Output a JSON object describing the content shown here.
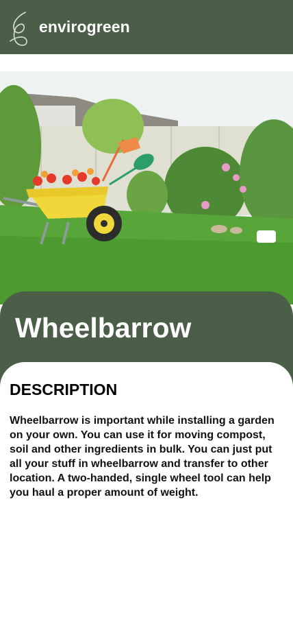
{
  "header": {
    "brand": "envirogreen",
    "logo_icon": "leaf-logo-icon",
    "background": "#4a5e48"
  },
  "hero": {
    "image_icon": "garden-wheelbarrow-image"
  },
  "product": {
    "title": "Wheelbarrow"
  },
  "description": {
    "heading": "DESCRIPTION",
    "text": "Wheelbarrow is important while installing a garden on your own. You can use it for moving compost, soil and other ingredients in bulk. You can just put all your stuff in wheelbarrow and transfer to other location. A two-handed, single wheel tool can help you haul a proper amount of weight."
  }
}
